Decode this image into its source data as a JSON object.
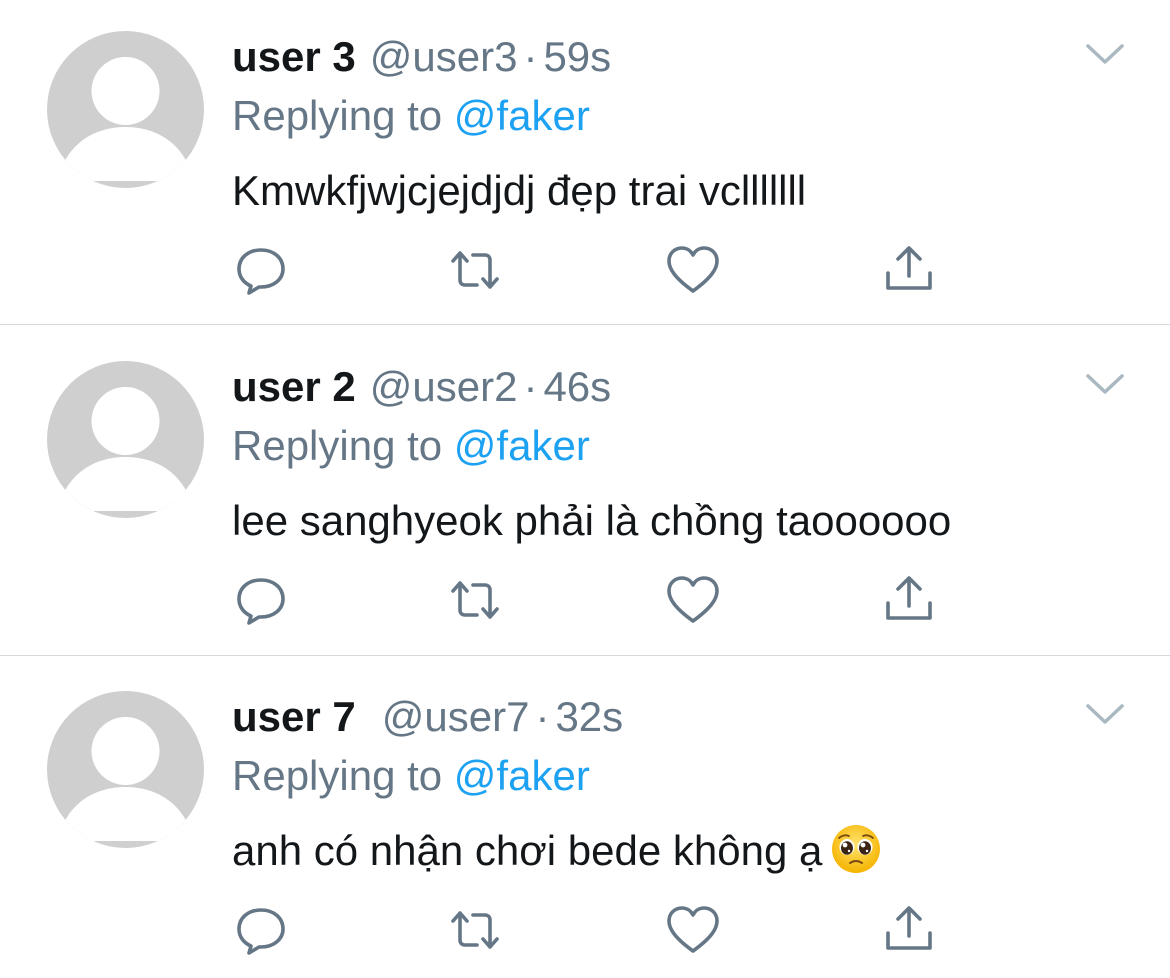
{
  "feed": {
    "replying_prefix": "Replying to",
    "tweets": [
      {
        "name": "user 3",
        "handle": "@user3",
        "separator": "·",
        "time": "59s",
        "replying_to": "@faker",
        "text": "Kmwkfjwjcjejdjdj đẹp trai vclllllll"
      },
      {
        "name": "user 2",
        "handle": "@user2",
        "separator": "·",
        "time": "46s",
        "replying_to": "@faker",
        "text": "lee sanghyeok phải là chồng taoooooo"
      },
      {
        "name": "user 7",
        "handle": "@user7",
        "separator": "·",
        "time": "32s",
        "replying_to": "@faker",
        "text": "anh có nhận chơi bede không ạ",
        "emoji": "pleading-face"
      }
    ]
  },
  "icons": {
    "caret": "chevron-down-icon",
    "reply": "reply-bubble-icon",
    "retweet": "retweet-icon",
    "like": "heart-icon",
    "share": "share-icon"
  },
  "colors": {
    "text_primary": "#14171a",
    "text_secondary": "#657786",
    "link": "#1da1f2",
    "avatar_bg": "#cfcfcf",
    "icon": "#657786",
    "divider": "#d4d9dd"
  }
}
